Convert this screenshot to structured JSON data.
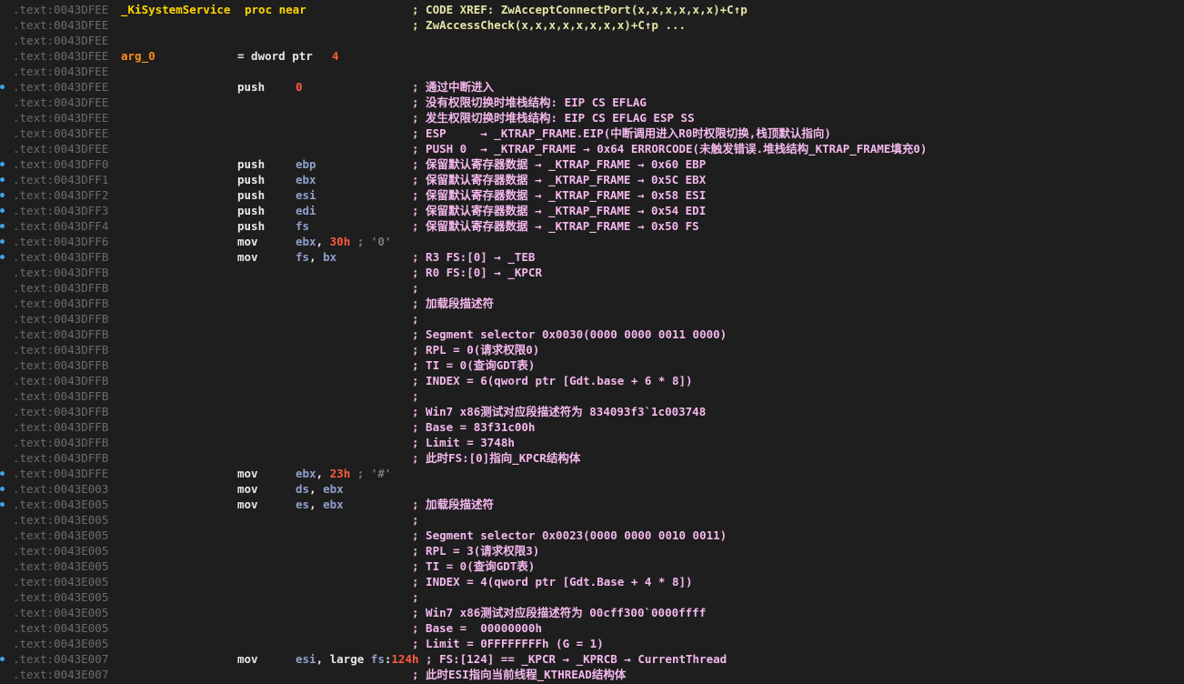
{
  "accent_colors": {
    "background": "#1e1e1e",
    "address": "#6b6b6b",
    "comment": "#f5b8ee",
    "xref": "#e6e6a8",
    "register": "#8fa0cc",
    "immediate": "#ff5a3c",
    "proc_name": "#ffd600",
    "breakpoint_marker": "#3fa3e8"
  },
  "lines": [
    {
      "addr": ".text:0043DFEE",
      "label": "_KiSystemService",
      "label_kind": "proc",
      "ops": [
        {
          "t": "proc near",
          "k": "kw"
        }
      ],
      "comment": "; CODE XREF: ZwAcceptConnectPort(x,x,x,x,x,x)+C↑p",
      "xref": true
    },
    {
      "addr": ".text:0043DFEE",
      "comment": "; ZwAccessCheck(x,x,x,x,x,x,x,x)+C↑p ...",
      "xref": true
    },
    {
      "addr": ".text:0043DFEE"
    },
    {
      "addr": ".text:0043DFEE",
      "label": "arg_0",
      "label_kind": "arg",
      "mnem": "= dword ptr",
      "ops": [
        {
          "t": "4",
          "k": "op-num"
        }
      ]
    },
    {
      "addr": ".text:0043DFEE"
    },
    {
      "addr": ".text:0043DFEE",
      "marker": true,
      "mnem": "push",
      "ops": [
        {
          "t": "0",
          "k": "op-num"
        }
      ],
      "comment": "; 通过中断进入"
    },
    {
      "addr": ".text:0043DFEE",
      "comment": "; 没有权限切换时堆栈结构: EIP CS EFLAG"
    },
    {
      "addr": ".text:0043DFEE",
      "comment": "; 发生权限切换时堆栈结构: EIP CS EFLAG ESP SS"
    },
    {
      "addr": ".text:0043DFEE",
      "comment": "; ESP     → _KTRAP_FRAME.EIP(中断调用进入R0时权限切换,栈顶默认指向)"
    },
    {
      "addr": ".text:0043DFEE",
      "comment": "; PUSH 0  → _KTRAP_FRAME → 0x64 ERRORCODE(未触发错误.堆栈结构_KTRAP_FRAME填充0)"
    },
    {
      "addr": ".text:0043DFF0",
      "marker": true,
      "mnem": "push",
      "ops": [
        {
          "t": "ebp",
          "k": "op-reg"
        }
      ],
      "comment": "; 保留默认寄存器数据 → _KTRAP_FRAME → 0x60 EBP"
    },
    {
      "addr": ".text:0043DFF1",
      "marker": true,
      "mnem": "push",
      "ops": [
        {
          "t": "ebx",
          "k": "op-reg"
        }
      ],
      "comment": "; 保留默认寄存器数据 → _KTRAP_FRAME → 0x5C EBX"
    },
    {
      "addr": ".text:0043DFF2",
      "marker": true,
      "mnem": "push",
      "ops": [
        {
          "t": "esi",
          "k": "op-reg"
        }
      ],
      "comment": "; 保留默认寄存器数据 → _KTRAP_FRAME → 0x58 ESI"
    },
    {
      "addr": ".text:0043DFF3",
      "marker": true,
      "mnem": "push",
      "ops": [
        {
          "t": "edi",
          "k": "op-reg"
        }
      ],
      "comment": "; 保留默认寄存器数据 → _KTRAP_FRAME → 0x54 EDI"
    },
    {
      "addr": ".text:0043DFF4",
      "marker": true,
      "mnem": "push",
      "ops": [
        {
          "t": "fs",
          "k": "op-reg"
        }
      ],
      "comment": "; 保留默认寄存器数据 → _KTRAP_FRAME → 0x50 FS"
    },
    {
      "addr": ".text:0043DFF6",
      "marker": true,
      "mnem": "mov",
      "ops": [
        {
          "t": "ebx",
          "k": "op-reg"
        },
        {
          "t": ", ",
          "k": "op-plain"
        },
        {
          "t": "30h",
          "k": "op-num"
        },
        {
          "t": " ; '0'",
          "k": "op-str"
        }
      ]
    },
    {
      "addr": ".text:0043DFFB",
      "marker": true,
      "mnem": "mov",
      "ops": [
        {
          "t": "fs",
          "k": "op-reg"
        },
        {
          "t": ", ",
          "k": "op-plain"
        },
        {
          "t": "bx",
          "k": "op-reg"
        }
      ],
      "comment": "; R3 FS:[0] → _TEB"
    },
    {
      "addr": ".text:0043DFFB",
      "comment": "; R0 FS:[0] → _KPCR"
    },
    {
      "addr": ".text:0043DFFB",
      "comment": ";"
    },
    {
      "addr": ".text:0043DFFB",
      "comment": "; 加载段描述符"
    },
    {
      "addr": ".text:0043DFFB",
      "comment": ";"
    },
    {
      "addr": ".text:0043DFFB",
      "comment": "; Segment selector 0x0030(0000 0000 0011 0000)"
    },
    {
      "addr": ".text:0043DFFB",
      "comment": "; RPL = 0(请求权限0)"
    },
    {
      "addr": ".text:0043DFFB",
      "comment": "; TI = 0(查询GDT表)"
    },
    {
      "addr": ".text:0043DFFB",
      "comment": "; INDEX = 6(qword ptr [Gdt.base + 6 * 8])"
    },
    {
      "addr": ".text:0043DFFB",
      "comment": ";"
    },
    {
      "addr": ".text:0043DFFB",
      "comment": "; Win7 x86测试对应段描述符为 834093f3`1c003748"
    },
    {
      "addr": ".text:0043DFFB",
      "comment": "; Base = 83f31c00h"
    },
    {
      "addr": ".text:0043DFFB",
      "comment": "; Limit = 3748h"
    },
    {
      "addr": ".text:0043DFFB",
      "comment": "; 此时FS:[0]指向_KPCR结构体"
    },
    {
      "addr": ".text:0043DFFE",
      "marker": true,
      "mnem": "mov",
      "ops": [
        {
          "t": "ebx",
          "k": "op-reg"
        },
        {
          "t": ", ",
          "k": "op-plain"
        },
        {
          "t": "23h",
          "k": "op-num"
        },
        {
          "t": " ; '#'",
          "k": "op-str"
        }
      ]
    },
    {
      "addr": ".text:0043E003",
      "marker": true,
      "mnem": "mov",
      "ops": [
        {
          "t": "ds",
          "k": "op-reg"
        },
        {
          "t": ", ",
          "k": "op-plain"
        },
        {
          "t": "ebx",
          "k": "op-reg"
        }
      ]
    },
    {
      "addr": ".text:0043E005",
      "marker": true,
      "mnem": "mov",
      "ops": [
        {
          "t": "es",
          "k": "op-reg"
        },
        {
          "t": ", ",
          "k": "op-plain"
        },
        {
          "t": "ebx",
          "k": "op-reg"
        }
      ],
      "comment": "; 加载段描述符"
    },
    {
      "addr": ".text:0043E005",
      "comment": ";"
    },
    {
      "addr": ".text:0043E005",
      "comment": "; Segment selector 0x0023(0000 0000 0010 0011)"
    },
    {
      "addr": ".text:0043E005",
      "comment": "; RPL = 3(请求权限3)"
    },
    {
      "addr": ".text:0043E005",
      "comment": "; TI = 0(查询GDT表)"
    },
    {
      "addr": ".text:0043E005",
      "comment": "; INDEX = 4(qword ptr [Gdt.Base + 4 * 8])"
    },
    {
      "addr": ".text:0043E005",
      "comment": ";"
    },
    {
      "addr": ".text:0043E005",
      "comment": "; Win7 x86测试对应段描述符为 00cff300`0000ffff"
    },
    {
      "addr": ".text:0043E005",
      "comment": "; Base =  00000000h"
    },
    {
      "addr": ".text:0043E005",
      "comment": "; Limit = 0FFFFFFFFh (G = 1)"
    },
    {
      "addr": ".text:0043E007",
      "marker": true,
      "mnem": "mov",
      "ops": [
        {
          "t": "esi",
          "k": "op-reg"
        },
        {
          "t": ", large ",
          "k": "op-plain"
        },
        {
          "t": "fs",
          "k": "op-seg"
        },
        {
          "t": ":",
          "k": "op-plain"
        },
        {
          "t": "124h",
          "k": "op-num"
        }
      ],
      "inline_comment": " ; FS:[124] == _KPCR → _KPRCB → CurrentThread"
    },
    {
      "addr": ".text:0043E007",
      "comment": "; 此时ESI指向当前线程_KTHREAD结构体"
    }
  ]
}
